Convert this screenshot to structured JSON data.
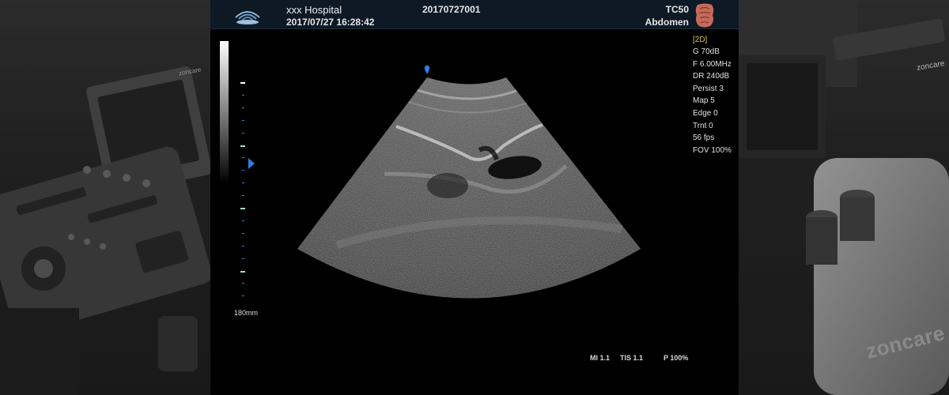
{
  "header": {
    "hospital": "xxx Hospital",
    "datetime": "2017/07/27 16:28:42",
    "patient_id": "20170727001",
    "probe_model": "TC50",
    "preset": "Abdomen",
    "probe_icon": "probe-icon",
    "organ_icon": "abdomen-organ-icon"
  },
  "scale": {
    "depth": "180mm",
    "focus_marker_icon": "focus-triangle-icon"
  },
  "params": {
    "mode": "[2D]",
    "items": [
      "G 70dB",
      "F 6.00MHz",
      "DR 240dB",
      "Persist 3",
      "Map 5",
      "Edge 0",
      "Trnt 0",
      "56 fps",
      "FOV 100%"
    ]
  },
  "readouts": {
    "mi": "MI 1.1",
    "tis": "TIS 1.1",
    "power": "P 100%"
  },
  "background": {
    "watermark": "zoncare"
  },
  "colors": {
    "header_bg": "#0d1a26",
    "mode_text": "#e3c24f",
    "accent_blue": "#2f7de0",
    "screen_bg": "#000000"
  }
}
